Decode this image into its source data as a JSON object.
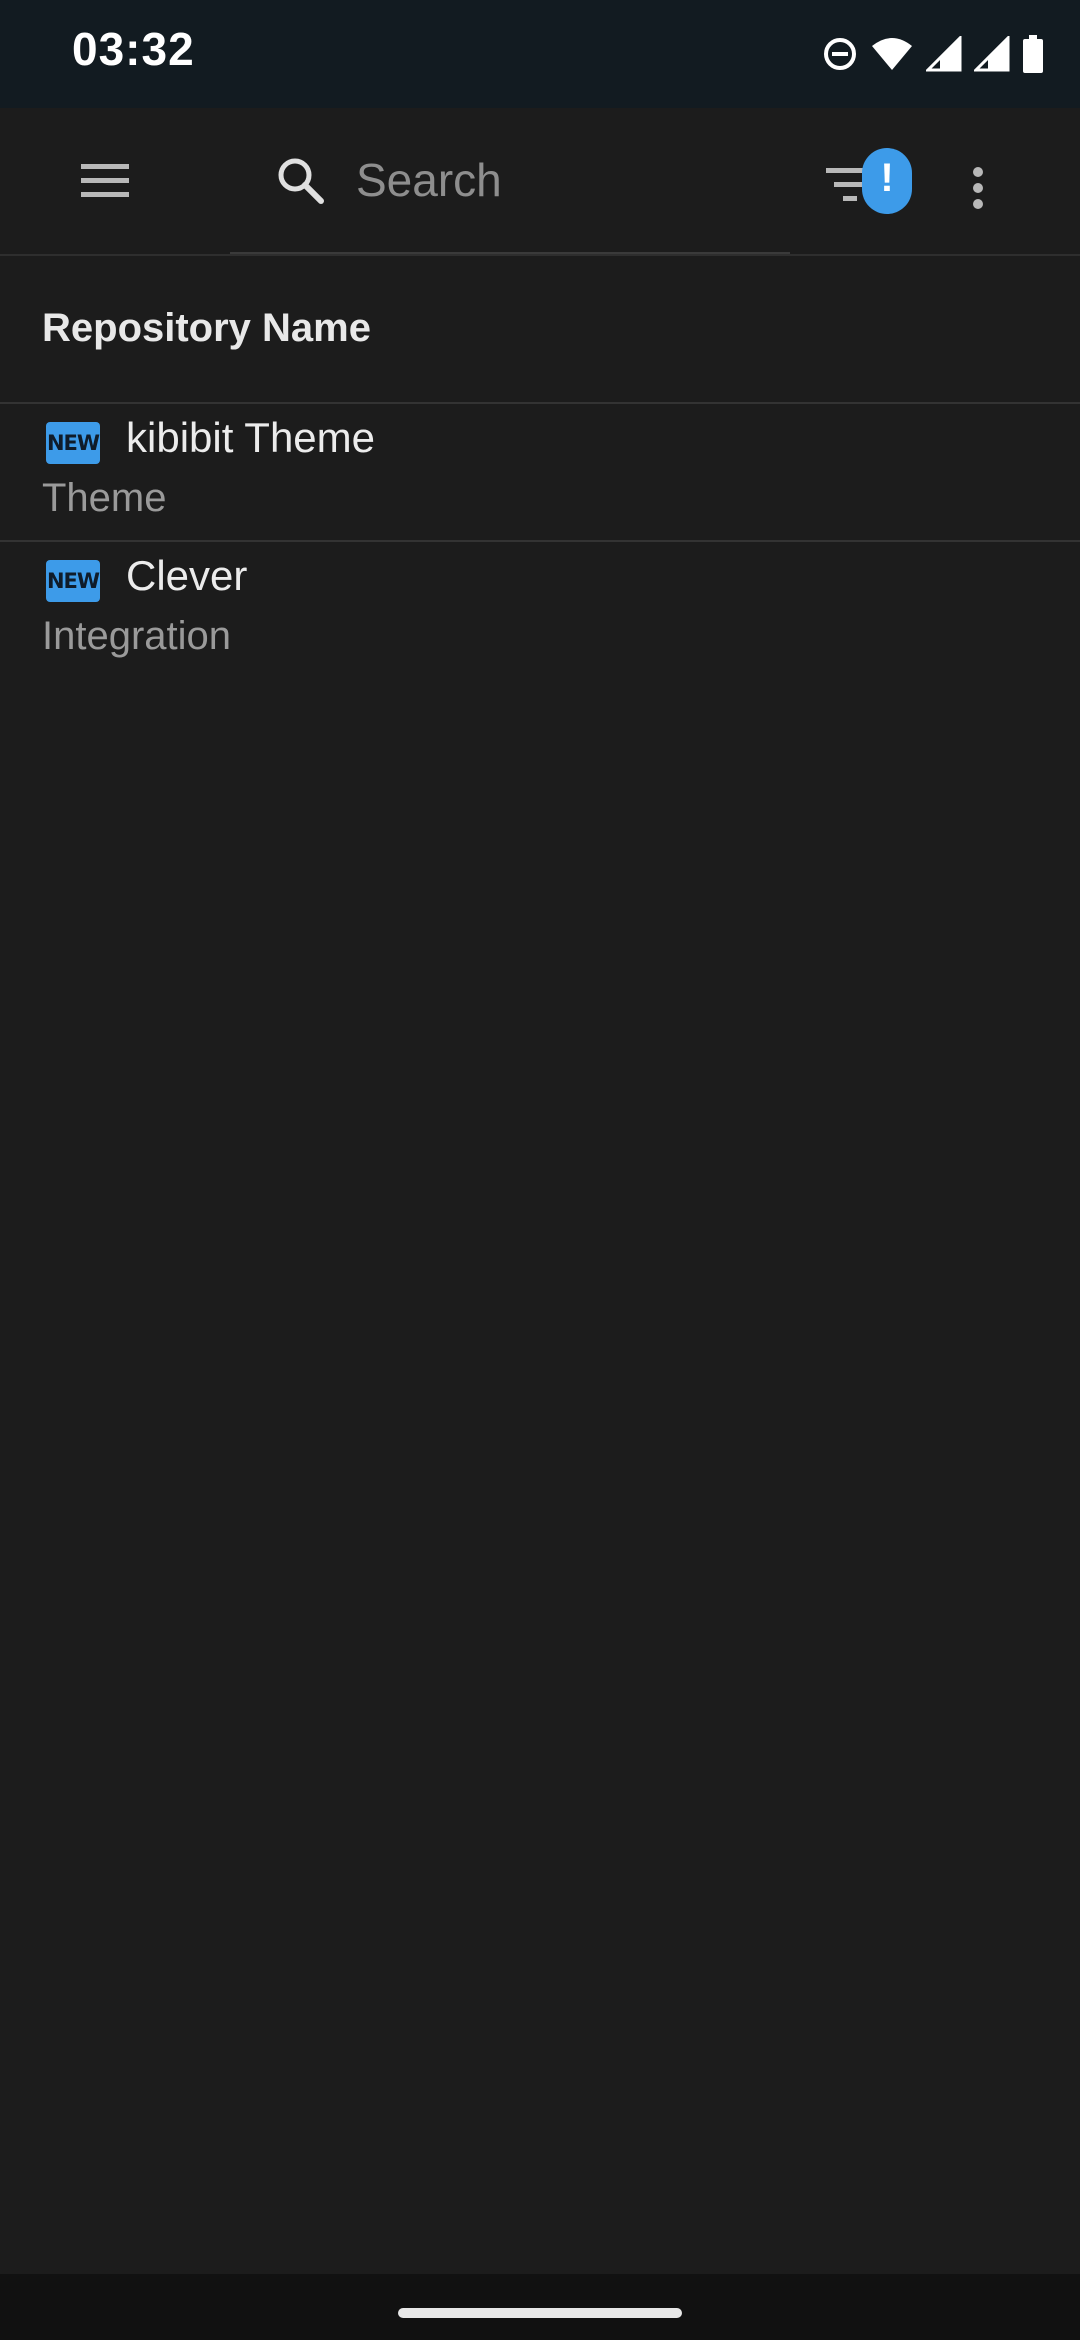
{
  "status_bar": {
    "time": "03:32",
    "icons": [
      "do-not-disturb-icon",
      "wifi-icon",
      "signal-icon",
      "signal-icon",
      "battery-icon"
    ]
  },
  "toolbar": {
    "menu_icon": "hamburger-menu-icon",
    "search": {
      "icon": "search-icon",
      "placeholder": "Search",
      "value": ""
    },
    "filter": {
      "icon": "filter-icon",
      "badge": "!",
      "badge_color": "#3d9be9"
    },
    "overflow_icon": "more-vert-icon"
  },
  "list": {
    "header": "Repository Name",
    "items": [
      {
        "badge": "NEW",
        "title": "kibibit Theme",
        "subtitle": "Theme"
      },
      {
        "badge": "NEW",
        "title": "Clever",
        "subtitle": "Integration"
      }
    ]
  },
  "colors": {
    "background": "#1c1c1c",
    "status_bar": "#121b21",
    "accent": "#3d9be9"
  }
}
